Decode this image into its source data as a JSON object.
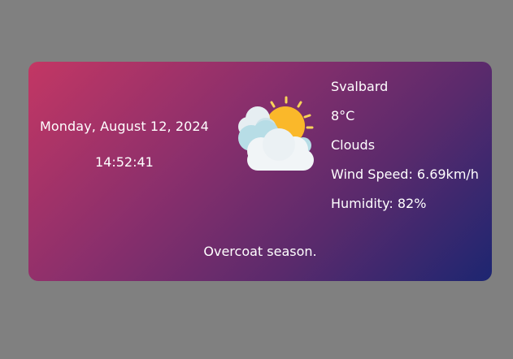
{
  "date": "Monday, August 12, 2024",
  "time": "14:52:41",
  "weather": {
    "city": "Svalbard",
    "temperature": "8°C",
    "condition": "Clouds",
    "wind": "Wind Speed: 6.69km/h",
    "humidity": "Humidity: 82%",
    "icon": "sun-behind-clouds-icon"
  },
  "message": "Overcoat season.",
  "colors": {
    "page_background": "#808080",
    "gradient_start": "#c33764",
    "gradient_end": "#1d2671",
    "text": "#ffffff"
  }
}
